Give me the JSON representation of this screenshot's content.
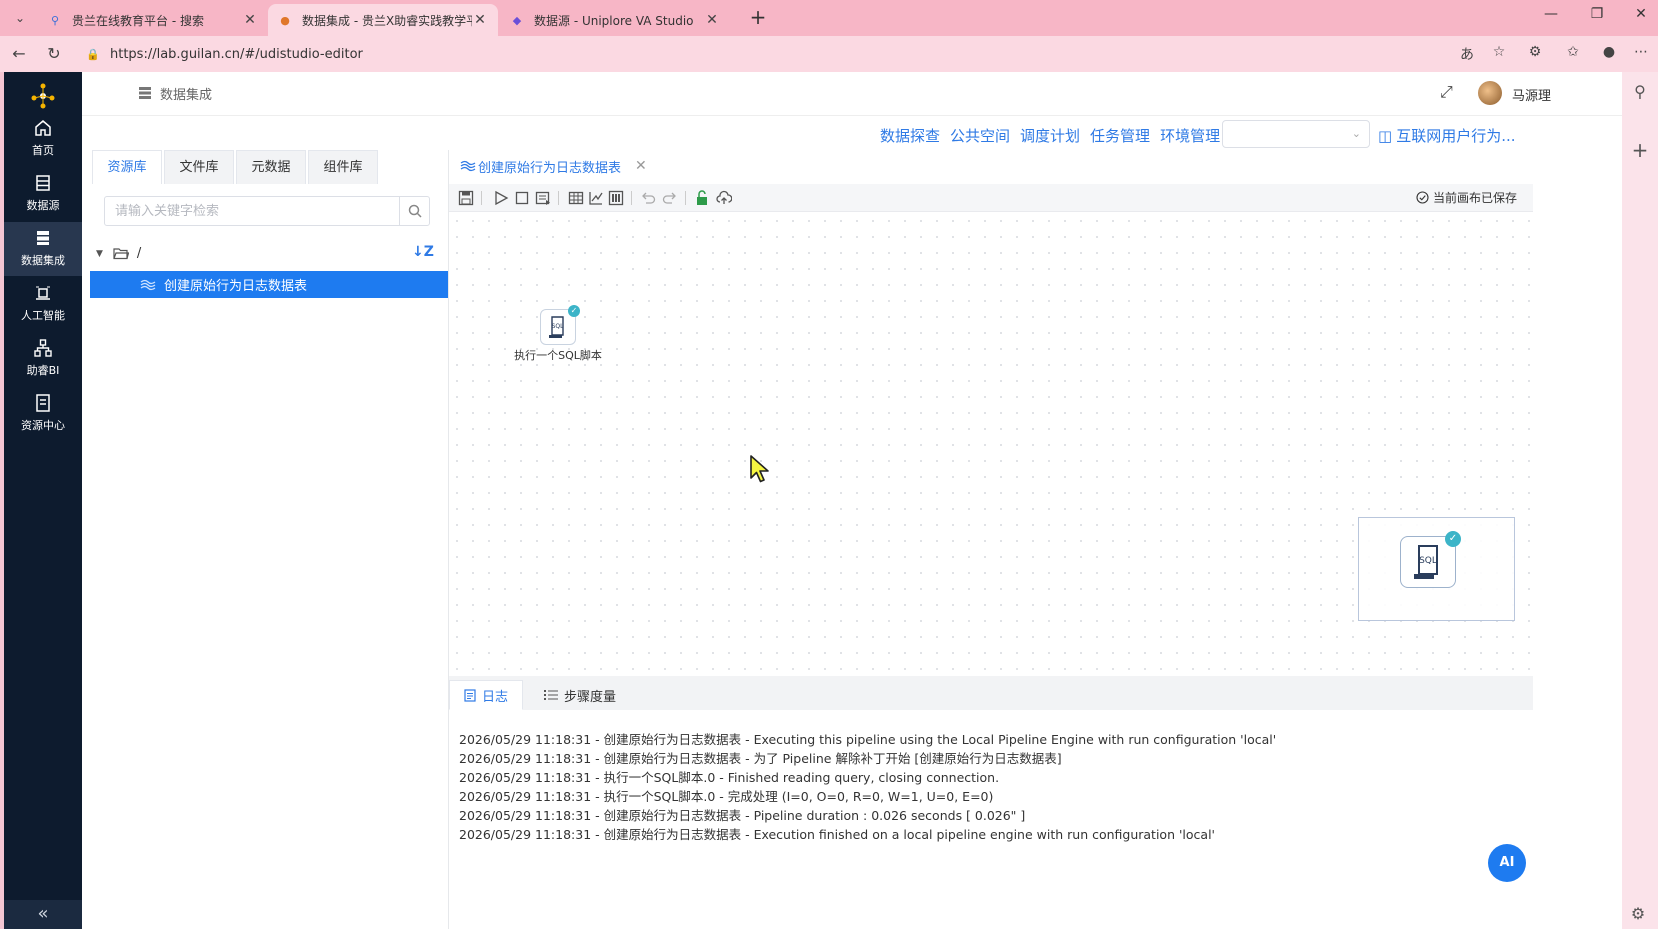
{
  "browser": {
    "tabs": [
      {
        "title": "贵兰在线教育平台 - 搜索",
        "active": false
      },
      {
        "title": "数据集成 - 贵兰X助睿实践教学平台",
        "active": true
      },
      {
        "title": "数据源 - Uniplore VA Studio",
        "active": false
      }
    ],
    "url": "https://lab.guilan.cn/#/udistudio-editor"
  },
  "app": {
    "nav": [
      {
        "label": "首页",
        "icon": "home-icon"
      },
      {
        "label": "数据源",
        "icon": "database-icon"
      },
      {
        "label": "数据集成",
        "icon": "data-integration-icon",
        "active": true
      },
      {
        "label": "人工智能",
        "icon": "ai-icon"
      },
      {
        "label": "助睿BI",
        "icon": "bi-icon"
      },
      {
        "label": "资源中心",
        "icon": "resource-icon"
      }
    ],
    "header_title": "数据集成",
    "user_name": "马源理",
    "top_menu": [
      "数据探查",
      "公共空间",
      "调度计划",
      "任务管理",
      "环境管理"
    ],
    "project_name": "互联网用户行为...",
    "resource_tabs": [
      "资源库",
      "文件库",
      "元数据",
      "组件库"
    ],
    "search_placeholder": "请输入关键字检索",
    "tree_root": "/",
    "tree_item": "创建原始行为日志数据表",
    "editor_tab": "创建原始行为日志数据表",
    "saved_status": "当前画布已保存",
    "node_label": "执行一个SQL脚本",
    "node_icon_text": "SQL",
    "log_tabs": [
      "日志",
      "步骤度量"
    ],
    "log_lines": [
      "2026/05/29 11:18:31 - 创建原始行为日志数据表 - Executing this pipeline using the Local Pipeline Engine with run configuration 'local'",
      "2026/05/29 11:18:31 - 创建原始行为日志数据表 - 为了 Pipeline 解除补丁开始 [创建原始行为日志数据表]",
      "2026/05/29 11:18:31 - 执行一个SQL脚本.0 - Finished reading query, closing connection.",
      "2026/05/29 11:18:31 - 执行一个SQL脚本.0 - 完成处理 (I=0, O=0, R=0, W=1, U=0, E=0)",
      "2026/05/29 11:18:31 - 创建原始行为日志数据表 - Pipeline duration : 0.026 seconds [  0.026\" ]",
      "2026/05/29 11:18:31 - 创建原始行为日志数据表 - Execution finished on a local pipeline engine with run configuration 'local'"
    ],
    "ai_label": "AI"
  },
  "colors": {
    "accent": "#1e7bf0",
    "link": "#2f7ae5",
    "nav_bg": "#0d1b2e",
    "browser_tab_bg": "#f7b6c6"
  }
}
